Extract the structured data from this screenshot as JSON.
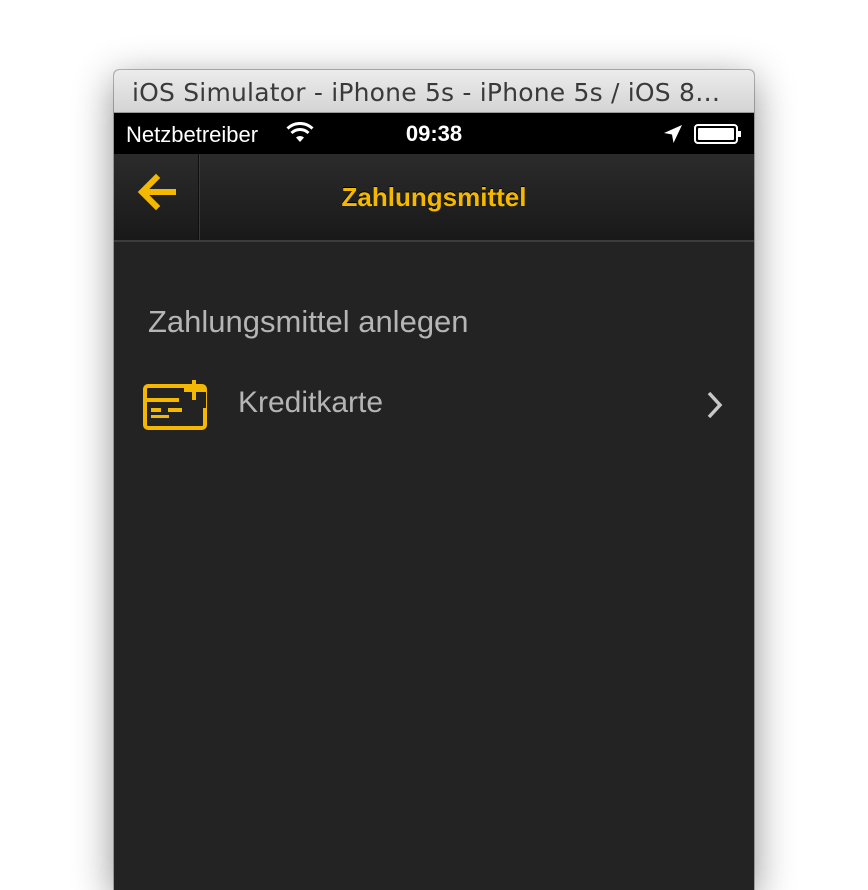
{
  "window": {
    "title": "iOS Simulator - iPhone 5s - iPhone 5s / iOS 8…"
  },
  "status_bar": {
    "carrier": "Netzbetreiber",
    "time": "09:38",
    "icons": [
      "wifi-icon",
      "location-icon",
      "battery-icon"
    ]
  },
  "nav": {
    "title": "Zahlungsmittel",
    "back_icon": "arrow-left-icon"
  },
  "content": {
    "section_title": "Zahlungsmittel anlegen",
    "rows": [
      {
        "label": "Kreditkarte",
        "icon": "add-credit-card-icon",
        "accessory": "chevron-right-icon"
      }
    ]
  },
  "colors": {
    "accent": "#f5b800",
    "background": "#232323",
    "text_secondary": "#b5b5b5",
    "status_bar": "#000000"
  }
}
